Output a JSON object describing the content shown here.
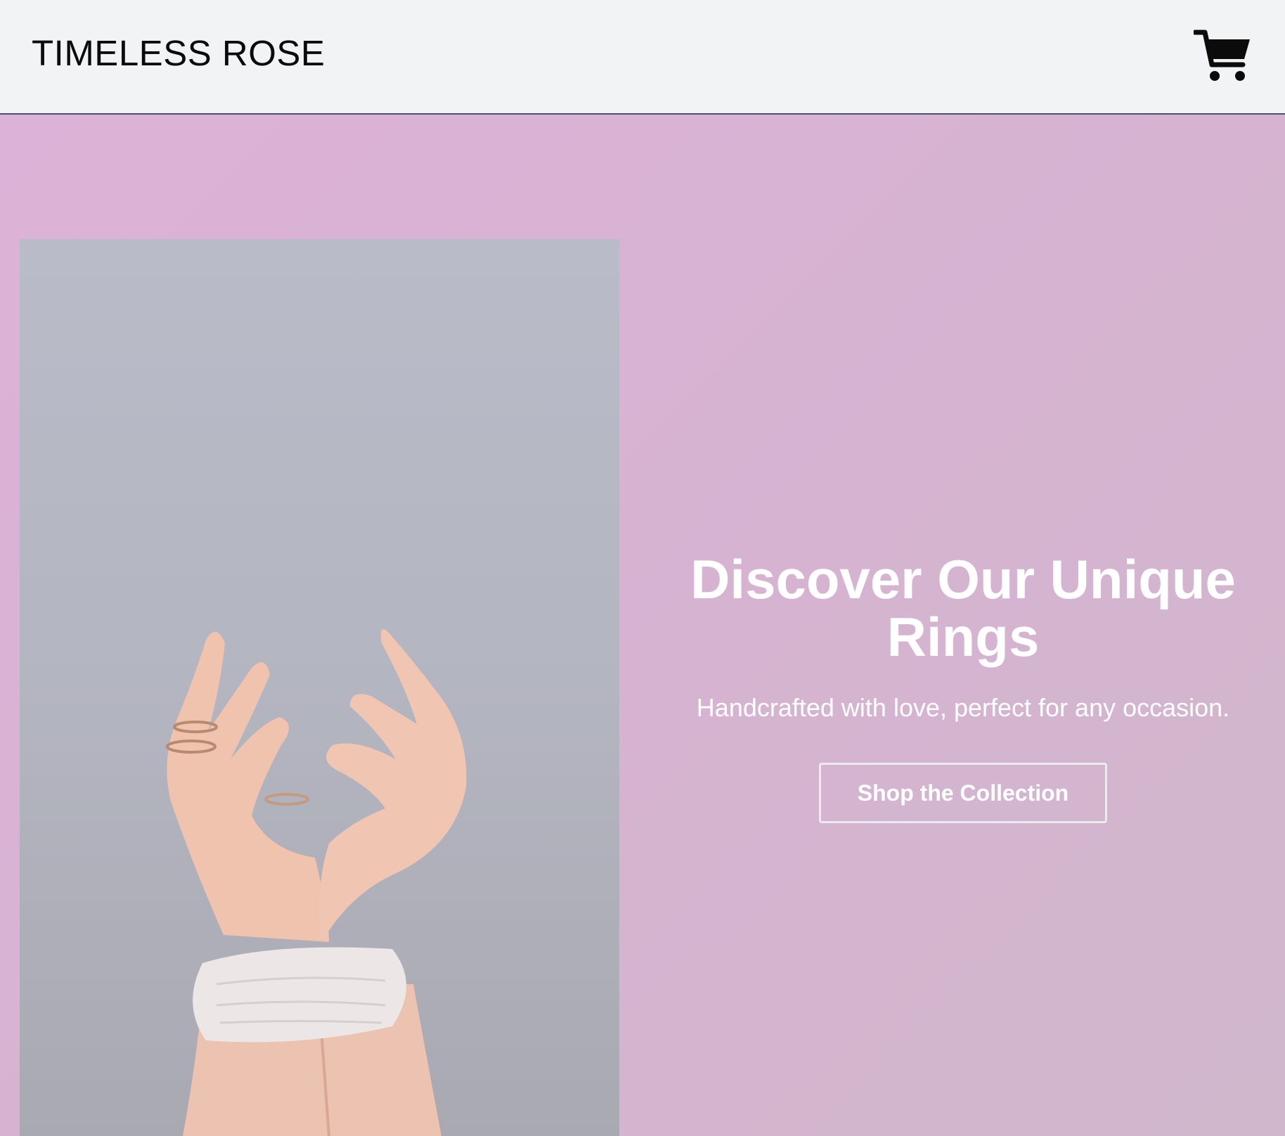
{
  "header": {
    "brand": "TIMELESS ROSE",
    "cart_icon": "shopping-cart-icon"
  },
  "hero": {
    "image_icon": "hands-with-rings-photo",
    "headline": "Discover Our Unique Rings",
    "subline": "Handcrafted with love, perfect for any occasion.",
    "cta_label": "Shop the Collection"
  },
  "colors": {
    "header_bg": "#f2f3f5",
    "hero_bg": "#d8b3d3",
    "photo_bg": "#b6b8c3",
    "text_light": "#ffffff",
    "brand_text": "#0b0b0b"
  }
}
